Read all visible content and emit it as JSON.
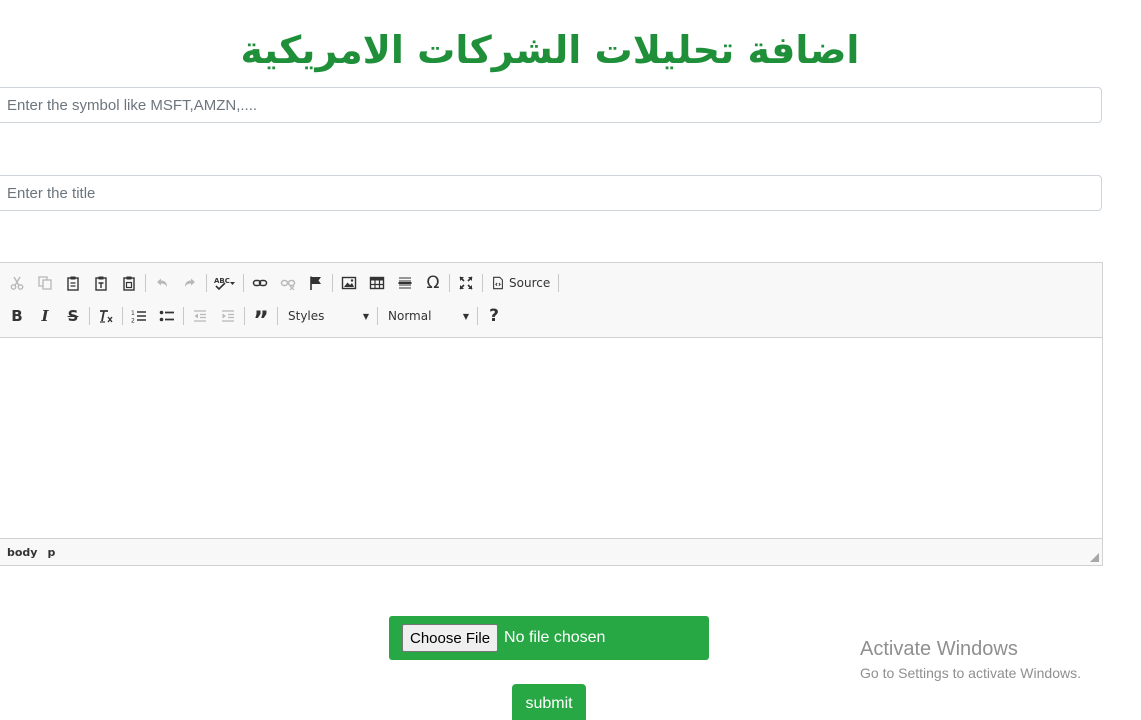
{
  "page": {
    "title": "اضافة تحليلات الشركات الامريكية"
  },
  "form": {
    "symbol_placeholder": "Enter the symbol like MSFT,AMZN,....",
    "title_placeholder": "Enter the title",
    "file_button_label": "Choose File",
    "file_status": "No file chosen",
    "submit_label": "submit"
  },
  "editor": {
    "toolbar_row1": [
      "cut-icon",
      "copy-icon",
      "paste-icon",
      "paste-text-icon",
      "paste-word-icon",
      "undo-icon",
      "redo-icon",
      "spellcheck-icon",
      "link-icon",
      "unlink-icon",
      "anchor-icon",
      "image-icon",
      "table-icon",
      "horizontal-rule-icon",
      "special-char-icon",
      "maximize-icon",
      "source-icon"
    ],
    "source_label": "Source",
    "toolbar_row2": [
      "bold-icon",
      "italic-icon",
      "strikethrough-icon",
      "remove-format-icon",
      "numbered-list-icon",
      "bulleted-list-icon",
      "outdent-icon",
      "indent-icon",
      "blockquote-icon",
      "help-icon"
    ],
    "styles_label": "Styles",
    "format_label": "Normal",
    "status_path": [
      "body",
      "p"
    ]
  },
  "watermark": {
    "line1": "Activate Windows",
    "line2": "Go to Settings to activate Windows."
  },
  "colors": {
    "accent": "#28a745",
    "title": "#1f8f3a"
  }
}
